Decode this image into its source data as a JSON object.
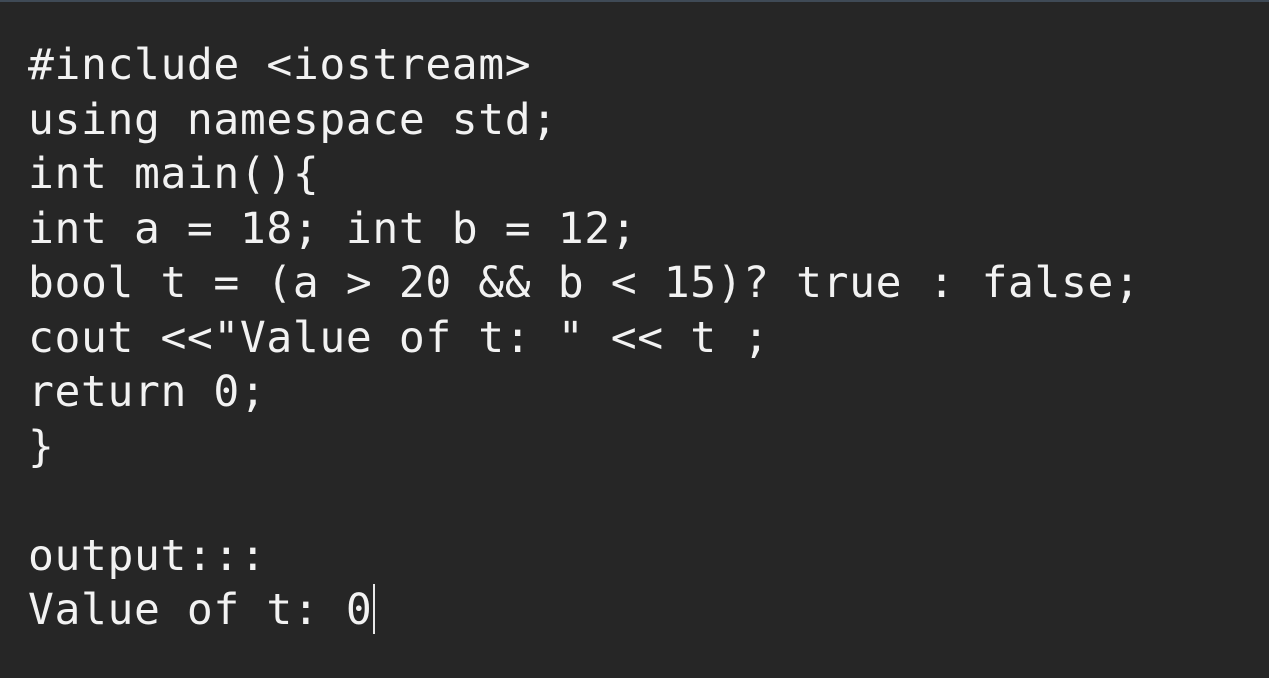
{
  "editor": {
    "lines": [
      "#include <iostream>",
      "using namespace std;",
      "int main(){",
      "int a = 18; int b = 12;",
      "bool t = (a > 20 && b < 15)? true : false;",
      "cout <<\"Value of t: \" << t ;",
      "return 0;",
      "}",
      "",
      "output:::",
      "Value of t: 0"
    ]
  },
  "colors": {
    "background": "#262626",
    "text": "#f2f2f2"
  }
}
